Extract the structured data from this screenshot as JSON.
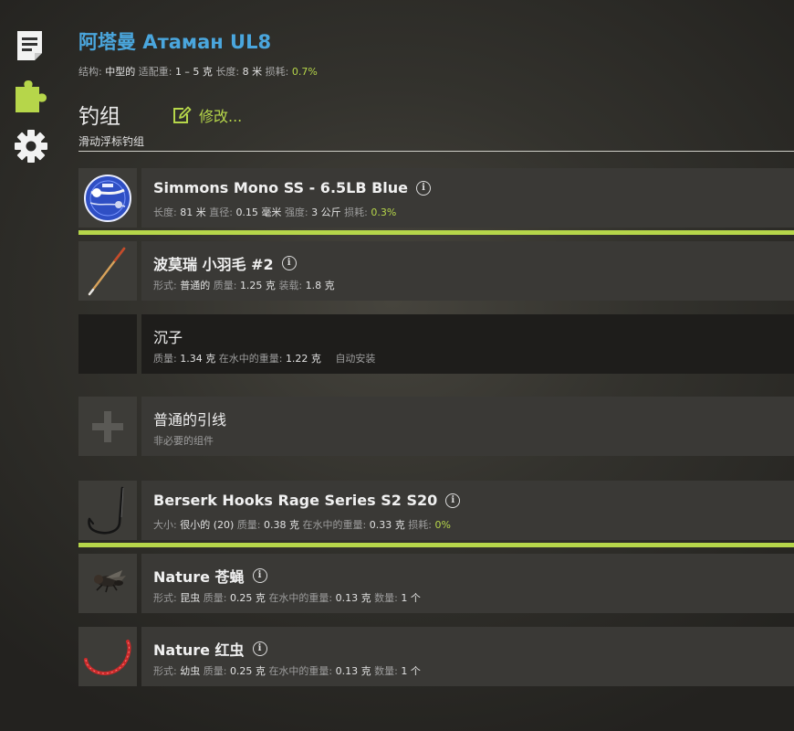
{
  "sidebar": {
    "icons": [
      "document-icon",
      "puzzle-icon",
      "gear-icon"
    ]
  },
  "rod": {
    "title": "阿塔曼 Атаман UL8",
    "structure_label": "结构:",
    "structure_value": "中型的",
    "load_label": "适配重:",
    "load_value": "1 – 5 克",
    "length_label": "长度:",
    "length_value": "8 米",
    "wear_label": "损耗:",
    "wear_value": "0.7%"
  },
  "rig": {
    "title": "钓组",
    "subtitle": "滑动浮标钓组",
    "modify_label": "修改..."
  },
  "slots": {
    "line": {
      "name": "Simmons Mono SS - 6.5LB Blue",
      "length_label": "长度:",
      "length_value": "81 米",
      "diameter_label": "直径:",
      "diameter_value": "0.15 毫米",
      "strength_label": "强度:",
      "strength_value": "3 公斤",
      "wear_label": "损耗:",
      "wear_value": "0.3%"
    },
    "float": {
      "name": "波莫瑞 小羽毛 #2",
      "form_label": "形式:",
      "form_value": "普通的",
      "weight_label": "质量:",
      "weight_value": "1.25 克",
      "load_label": "装载:",
      "load_value": "1.8 克"
    },
    "sinker": {
      "name": "沉子",
      "weight_label": "质量:",
      "weight_value": "1.34 克",
      "water_label": "在水中的重量:",
      "water_value": "1.22 克",
      "auto": "自动安装"
    },
    "leader": {
      "name": "普通的引线",
      "note": "非必要的组件"
    },
    "hook": {
      "name": "Berserk Hooks Rage Series S2 S20",
      "size_label": "大小:",
      "size_value": "很小的",
      "size_num": "(20)",
      "weight_label": "质量:",
      "weight_value": "0.38 克",
      "water_label": "在水中的重量:",
      "water_value": "0.33 克",
      "wear_label": "损耗:",
      "wear_value": "0%"
    },
    "bait1": {
      "name": "Nature 苍蝇",
      "form_label": "形式:",
      "form_value": "昆虫",
      "weight_label": "质量:",
      "weight_value": "0.25 克",
      "water_label": "在水中的重量:",
      "water_value": "0.13 克",
      "count_label": "数量:",
      "count_value": "1 个"
    },
    "bait2": {
      "name": "Nature 红虫",
      "form_label": "形式:",
      "form_value": "幼虫",
      "weight_label": "质量:",
      "weight_value": "0.25 克",
      "water_label": "在水中的重量:",
      "water_value": "0.13 克",
      "count_label": "数量:",
      "count_value": "1 个"
    }
  },
  "colors": {
    "accent": "#b6d64a",
    "title_blue": "#4aa6dd"
  }
}
